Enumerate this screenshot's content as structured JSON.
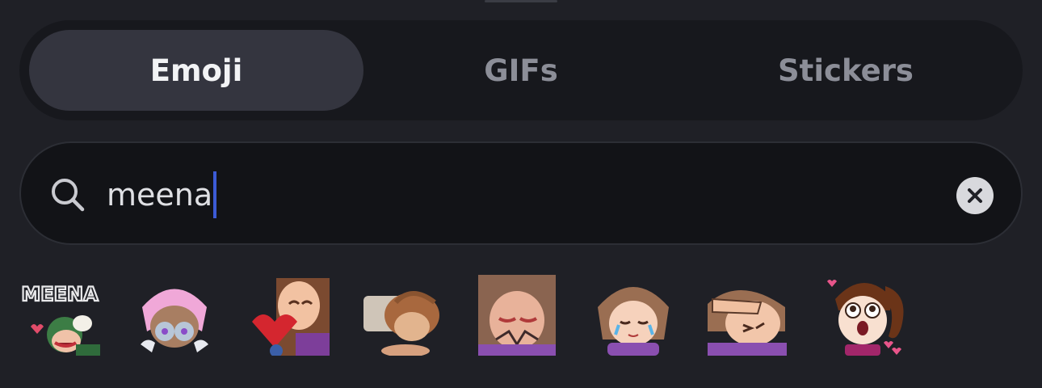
{
  "tabs": [
    {
      "label": "Emoji",
      "active": true
    },
    {
      "label": "GIFs",
      "active": false
    },
    {
      "label": "Stickers",
      "active": false
    }
  ],
  "search": {
    "value": "meena",
    "icon": "search-icon",
    "clear_icon": "close-icon"
  },
  "results": {
    "items": [
      {
        "name": "meena-text-sticker",
        "text": "MEENA"
      },
      {
        "name": "pink-hair-sticker"
      },
      {
        "name": "heart-hug-sticker"
      },
      {
        "name": "hand-grab-sticker"
      },
      {
        "name": "crying-sticker"
      },
      {
        "name": "teary-smile-sticker"
      },
      {
        "name": "facepalm-sticker"
      },
      {
        "name": "surprised-hearts-sticker"
      }
    ]
  },
  "colors": {
    "background": "#1f2026",
    "tab_bar": "#17181d",
    "active_tab": "#34353f",
    "search_bg": "#121317",
    "caret": "#3c5bd6"
  }
}
